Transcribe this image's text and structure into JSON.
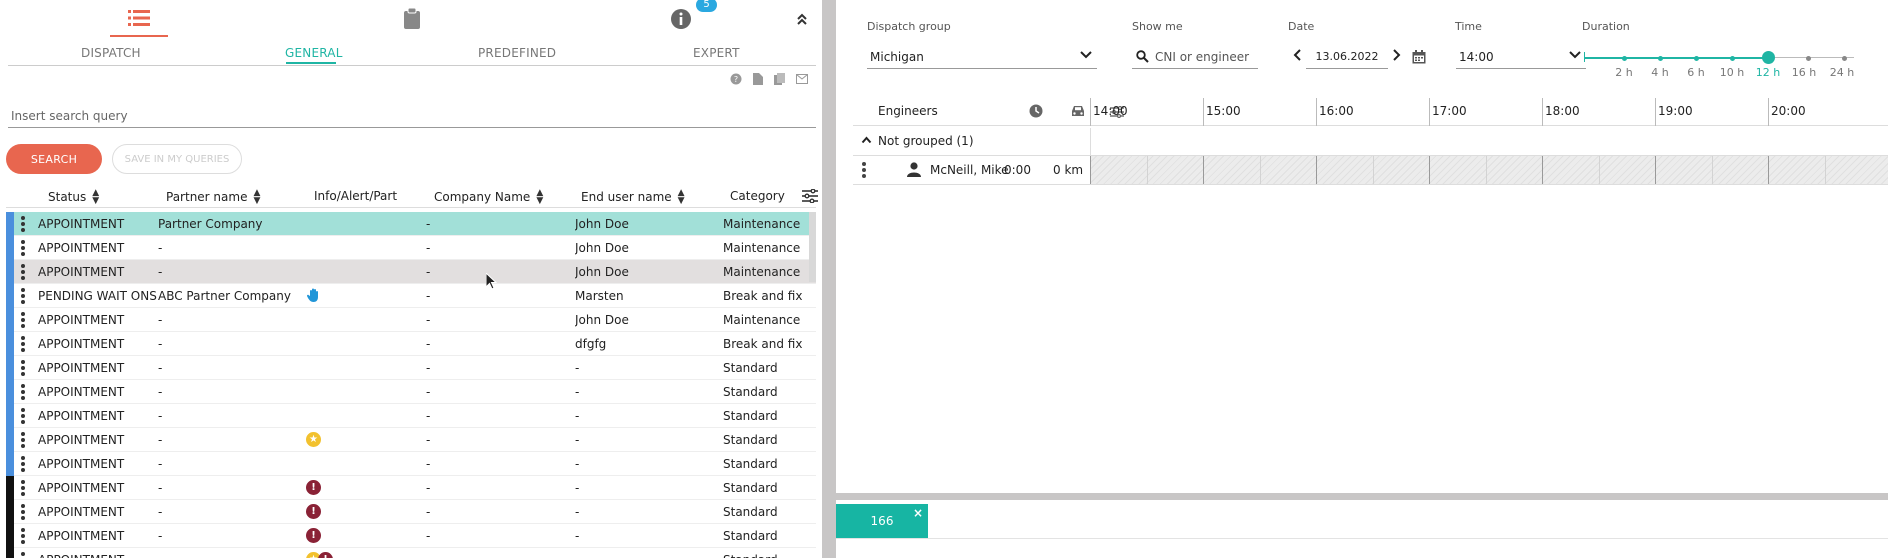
{
  "left": {
    "info_badge": "5",
    "tabs": [
      "DISPATCH",
      "GENERAL",
      "PREDEFINED",
      "EXPERT"
    ],
    "active_tab": "GENERAL",
    "search_placeholder": "Insert search query",
    "search_button": "SEARCH",
    "save_button": "SAVE IN MY QUERIES",
    "columns": [
      "Status",
      "Partner name",
      "Info/Alert/Part",
      "Company Name",
      "End user name",
      "Category"
    ],
    "rows": [
      {
        "status": "APPOINTMENT",
        "partner": "Partner Company",
        "info": "",
        "company": "-",
        "end_user": "John Doe",
        "category": "Maintenance",
        "stripe": "#4a8fdd",
        "state": "sel"
      },
      {
        "status": "APPOINTMENT",
        "partner": "-",
        "info": "",
        "company": "-",
        "end_user": "John Doe",
        "category": "Maintenance",
        "stripe": "#4a8fdd",
        "state": ""
      },
      {
        "status": "APPOINTMENT",
        "partner": "-",
        "info": "",
        "company": "-",
        "end_user": "John Doe",
        "category": "Maintenance",
        "stripe": "#4a8fdd",
        "state": "hover"
      },
      {
        "status": "PENDING WAIT ONS...",
        "partner": "ABC Partner Company",
        "info": "hand",
        "company": "-",
        "end_user": "Marsten",
        "category": "Break and fix",
        "stripe": "#4a8fdd",
        "state": ""
      },
      {
        "status": "APPOINTMENT",
        "partner": "-",
        "info": "",
        "company": "-",
        "end_user": "John Doe",
        "category": "Maintenance",
        "stripe": "#4a8fdd",
        "state": ""
      },
      {
        "status": "APPOINTMENT",
        "partner": "-",
        "info": "",
        "company": "-",
        "end_user": "dfgfg",
        "category": "Break and fix",
        "stripe": "#4a8fdd",
        "state": ""
      },
      {
        "status": "APPOINTMENT",
        "partner": "-",
        "info": "",
        "company": "-",
        "end_user": "-",
        "category": "Standard",
        "stripe": "#4a8fdd",
        "state": ""
      },
      {
        "status": "APPOINTMENT",
        "partner": "-",
        "info": "",
        "company": "-",
        "end_user": "-",
        "category": "Standard",
        "stripe": "#4a8fdd",
        "state": ""
      },
      {
        "status": "APPOINTMENT",
        "partner": "-",
        "info": "",
        "company": "-",
        "end_user": "-",
        "category": "Standard",
        "stripe": "#4a8fdd",
        "state": ""
      },
      {
        "status": "APPOINTMENT",
        "partner": "-",
        "info": "star",
        "company": "-",
        "end_user": "-",
        "category": "Standard",
        "stripe": "#4a8fdd",
        "state": ""
      },
      {
        "status": "APPOINTMENT",
        "partner": "-",
        "info": "",
        "company": "-",
        "end_user": "-",
        "category": "Standard",
        "stripe": "#4a8fdd",
        "state": ""
      },
      {
        "status": "APPOINTMENT",
        "partner": "-",
        "info": "alert",
        "company": "-",
        "end_user": "-",
        "category": "Standard",
        "stripe": "#111111",
        "state": ""
      },
      {
        "status": "APPOINTMENT",
        "partner": "-",
        "info": "alert",
        "company": "-",
        "end_user": "-",
        "category": "Standard",
        "stripe": "#111111",
        "state": ""
      },
      {
        "status": "APPOINTMENT",
        "partner": "-",
        "info": "alert",
        "company": "-",
        "end_user": "-",
        "category": "Standard",
        "stripe": "#111111",
        "state": ""
      },
      {
        "status": "APPOINTMENT",
        "partner": "-",
        "info": "star-alert",
        "company": "-",
        "end_user": "-",
        "category": "Standard",
        "stripe": "#111111",
        "state": ""
      }
    ]
  },
  "right": {
    "dispatch_group_label": "Dispatch group",
    "dispatch_group_value": "Michigan",
    "show_me_label": "Show me",
    "show_me_placeholder": "CNI or engineer",
    "date_label": "Date",
    "date_value": "13.06.2022",
    "time_label": "Time",
    "time_value": "14:00",
    "duration_label": "Duration",
    "durations": [
      "2 h",
      "4 h",
      "6 h",
      "10 h",
      "12 h",
      "16 h",
      "24 h"
    ],
    "duration_selected": "12 h",
    "engineers_label": "Engineers",
    "hours": [
      "14:00",
      "15:00",
      "16:00",
      "17:00",
      "18:00",
      "19:00",
      "20:00"
    ],
    "group_label": "Not grouped (1)",
    "engineer": {
      "name": "McNeill, Mike",
      "time": "0:00",
      "distance": "0 km"
    }
  },
  "bottom": {
    "tab_label": "166"
  },
  "colors": {
    "accent": "#1fb5a4",
    "primary_button": "#e8664f",
    "selected_row": "#a2e0d8"
  }
}
